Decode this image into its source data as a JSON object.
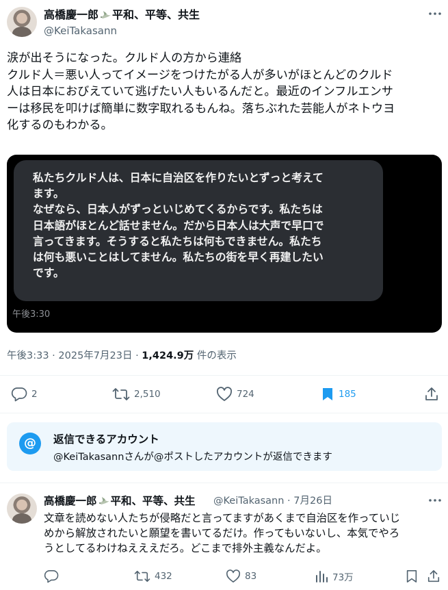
{
  "post": {
    "author_name": "高橋慶一郎",
    "author_name_suffix": "平和、平等、共生",
    "author_handle": "@KeiTakasann",
    "text_lines": [
      "涙が出そうになった。クルド人の方から連絡",
      "クルド人＝悪い人ってイメージをつけたがる人が多いがほとんどのクルド",
      "人は日本におびえていて逃げたい人もいるんだと。最近のインフルエンサ",
      "ーは移民を叩けば簡単に数字取れるもんね。落ちぶれた芸能人がネトウヨ",
      "化するのもわかる。"
    ],
    "media": {
      "bubble_lines": [
        "私たちクルド人は、日本に自治区を作りたいとずっと考えて",
        "ます。",
        "なぜなら、日本人がずっといじめてくるからです。私たちは",
        "日本語がほとんど話せません。だから日本人は大声で早口で",
        "言ってきます。そうすると私たちは何もできません。私たち",
        "は何も悪いことはしてません。私たちの街を早く再建したい",
        "です。"
      ],
      "message_time": "午後3:30"
    },
    "timestamp": "午後3:33 · 2025年7月23日",
    "separator": " · ",
    "views_count": "1,424.9万",
    "views_label": " 件の表示",
    "stats": {
      "replies": "2",
      "reposts": "2,510",
      "likes": "724",
      "bookmarks": "185"
    }
  },
  "reply_notice": {
    "title": "返信できるアカウント",
    "description": "@KeiTakasannさんが@ポストしたアカウントが返信できます",
    "icon_glyph": "@"
  },
  "reply": {
    "author_name": "高橋慶一郎",
    "author_name_suffix": "平和、平等、共生",
    "author_handle": "@KeiTakasann",
    "date": "· 7月26日",
    "text_lines": [
      "文章を読めない人たちが侵略だと言ってますがあくまで自治区を作っていじ",
      "めから解放されたいと願望を書いてるだけ。作ってもいないし、本気でやろ",
      "うとしてるわけねえええだろ。どこまで排外主義なんだよ。"
    ],
    "stats": {
      "replies": "",
      "reposts": "432",
      "likes": "83",
      "views": "73万"
    }
  },
  "colors": {
    "accent": "#1d9bf0",
    "text": "#0f1419",
    "muted": "#536471",
    "notice_bg": "#eef7fd"
  },
  "icons": [
    "more-icon",
    "dove-icon",
    "reply-icon",
    "repost-icon",
    "like-icon",
    "bookmark-icon",
    "share-icon",
    "views-icon",
    "at-icon"
  ]
}
